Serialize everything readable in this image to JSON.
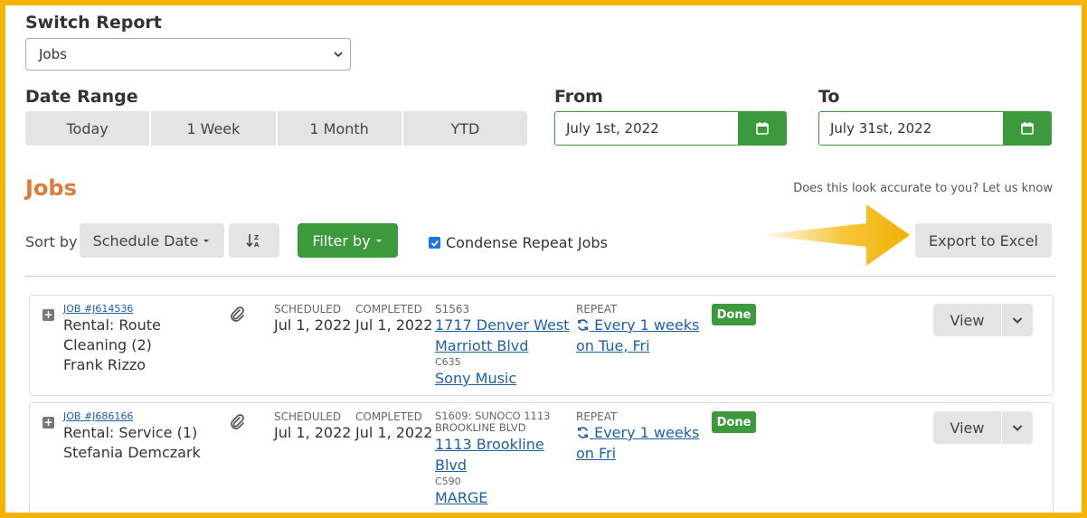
{
  "switch_report": {
    "label": "Switch Report",
    "selected": "Jobs"
  },
  "date_range": {
    "label": "Date Range",
    "options": [
      "Today",
      "1 Week",
      "1 Month",
      "YTD"
    ]
  },
  "from": {
    "label": "From",
    "value": "July 1st, 2022"
  },
  "to": {
    "label": "To",
    "value": "July 31st, 2022"
  },
  "section_title": "Jobs",
  "feedback_text": "Does this look accurate to you? Let us know",
  "toolbar": {
    "sort_label": "Sort by",
    "sort_value": "Schedule Date",
    "filter_label": "Filter by",
    "condense_label": "Condense Repeat Jobs",
    "condense_checked": true,
    "export_label": "Export to Excel"
  },
  "colors": {
    "accent_green": "#3c9a3c",
    "title_orange": "#e07a3a",
    "frame_yellow": "#f5b400",
    "link_blue": "#1f5fa8"
  },
  "jobs": [
    {
      "job_id": "JOB #J614536",
      "lines": [
        "Rental: Route",
        "Cleaning (2)",
        "Frank Rizzo"
      ],
      "scheduled_label": "SCHEDULED",
      "scheduled": "Jul 1, 2022",
      "completed_label": "COMPLETED",
      "completed": "Jul 1, 2022",
      "site_code": "S1563",
      "site_addr_1": "1717 Denver West",
      "site_addr_2": "Marriott Blvd",
      "customer_code": "C635",
      "customer": "Sony Music",
      "repeat_label": "REPEAT",
      "repeat_1": "Every 1 weeks",
      "repeat_2": "on Tue, Fri",
      "status": "Done",
      "view_label": "View"
    },
    {
      "job_id": "JOB #J686166",
      "lines": [
        "Rental: Service (1)",
        "Stefania Demczark"
      ],
      "scheduled_label": "SCHEDULED",
      "scheduled": "Jul 1, 2022",
      "completed_label": "COMPLETED",
      "completed": "Jul 1, 2022",
      "site_code_1": "S1609: SUNOCO 1113",
      "site_code_2": "BROOKLINE BLVD",
      "site_addr_1": "1113 Brookline",
      "site_addr_2": "Blvd",
      "customer_code": "C590",
      "customer": "MARGE",
      "repeat_label": "REPEAT",
      "repeat_1": "Every 1 weeks",
      "repeat_2": "on Fri",
      "status": "Done",
      "view_label": "View"
    }
  ]
}
